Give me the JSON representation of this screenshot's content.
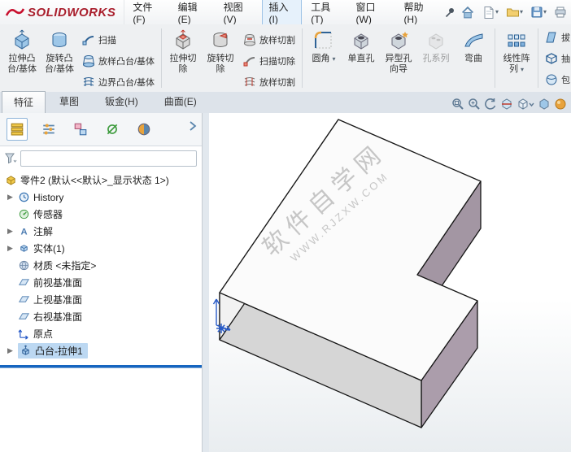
{
  "menu_bar": {
    "brand": "SOLIDWORKS",
    "menus": [
      "文件(F)",
      "编辑(E)",
      "视图(V)",
      "插入(I)",
      "工具(T)",
      "窗口(W)",
      "帮助(H)"
    ],
    "active_menu": "插入(I)"
  },
  "ribbon": {
    "extrude_boss": "拉伸凸台/基体",
    "revolve_boss": "旋转凸台/基体",
    "sweep": "扫描",
    "loft": "放样凸台/基体",
    "boundary": "边界凸台/基体",
    "extrude_cut": "拉伸切除",
    "revolve_cut": "旋转切除",
    "loft_cut": "放样切割",
    "sweep_cut": "扫描切除",
    "boundary_cut": "放样切割",
    "fillet": "圆角",
    "simple_hole": "单直孔",
    "hole_wizard": "异型孔向导",
    "hole_series": "孔系列",
    "flex": "弯曲",
    "linear_pattern": "线性阵列",
    "draft": "拔",
    "shell": "抽",
    "wrap": "包"
  },
  "tabs": {
    "items": [
      "特征",
      "草图",
      "钣金(H)",
      "曲面(E)"
    ],
    "active": "特征"
  },
  "feature_tree": {
    "root": "零件2 (默认<<默认>_显示状态 1>)",
    "items": [
      "History",
      "传感器",
      "注解",
      "实体(1)",
      "材质 <未指定>",
      "前视基准面",
      "上视基准面",
      "右视基准面",
      "原点",
      "凸台-拉伸1"
    ],
    "selected": "凸台-拉伸1"
  },
  "viewport": {
    "watermark_line1": "软件自学网",
    "watermark_line2": "WWW.RJZXW.COM"
  },
  "colors": {
    "selection": "#bcd8f2",
    "rollback": "#1565c0",
    "purple_face": "#a396a3",
    "brand_red": "#a91e2c"
  }
}
